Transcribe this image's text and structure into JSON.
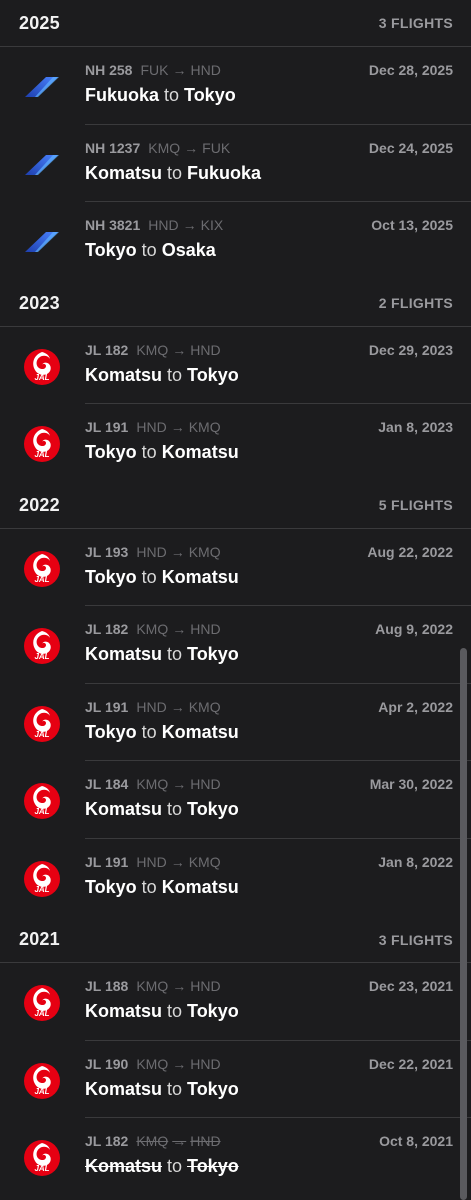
{
  "sections": [
    {
      "year": "2025",
      "count": "3 FLIGHTS",
      "flights": [
        {
          "airline": "ana-logo",
          "flight": "NH 258",
          "from": "FUK",
          "arrow": "→",
          "to_code": "HND",
          "date": "Dec 28, 2025",
          "origin": "Fukuoka",
          "connector": "to",
          "destination": "Tokyo"
        },
        {
          "airline": "ana-logo",
          "flight": "NH 1237",
          "from": "KMQ",
          "arrow": "→",
          "to_code": "FUK",
          "date": "Dec 24, 2025",
          "origin": "Komatsu",
          "connector": "to",
          "destination": "Fukuoka"
        },
        {
          "airline": "ana-logo",
          "flight": "NH 3821",
          "from": "HND",
          "arrow": "→",
          "to_code": "KIX",
          "date": "Oct 13, 2025",
          "origin": "Tokyo",
          "connector": "to",
          "destination": "Osaka"
        }
      ]
    },
    {
      "year": "2023",
      "count": "2 FLIGHTS",
      "flights": [
        {
          "airline": "jal-logo",
          "flight": "JL 182",
          "from": "KMQ",
          "arrow": "→",
          "to_code": "HND",
          "date": "Dec 29, 2023",
          "origin": "Komatsu",
          "connector": "to",
          "destination": "Tokyo"
        },
        {
          "airline": "jal-logo",
          "flight": "JL 191",
          "from": "HND",
          "arrow": "→",
          "to_code": "KMQ",
          "date": "Jan 8, 2023",
          "origin": "Tokyo",
          "connector": "to",
          "destination": "Komatsu"
        }
      ]
    },
    {
      "year": "2022",
      "count": "5 FLIGHTS",
      "flights": [
        {
          "airline": "jal-logo",
          "flight": "JL 193",
          "from": "HND",
          "arrow": "→",
          "to_code": "KMQ",
          "date": "Aug 22, 2022",
          "origin": "Tokyo",
          "connector": "to",
          "destination": "Komatsu"
        },
        {
          "airline": "jal-logo",
          "flight": "JL 182",
          "from": "KMQ",
          "arrow": "→",
          "to_code": "HND",
          "date": "Aug 9, 2022",
          "origin": "Komatsu",
          "connector": "to",
          "destination": "Tokyo"
        },
        {
          "airline": "jal-logo",
          "flight": "JL 191",
          "from": "HND",
          "arrow": "→",
          "to_code": "KMQ",
          "date": "Apr 2, 2022",
          "origin": "Tokyo",
          "connector": "to",
          "destination": "Komatsu"
        },
        {
          "airline": "jal-logo",
          "flight": "JL 184",
          "from": "KMQ",
          "arrow": "→",
          "to_code": "HND",
          "date": "Mar 30, 2022",
          "origin": "Komatsu",
          "connector": "to",
          "destination": "Tokyo"
        },
        {
          "airline": "jal-logo",
          "flight": "JL 191",
          "from": "HND",
          "arrow": "→",
          "to_code": "KMQ",
          "date": "Jan 8, 2022",
          "origin": "Tokyo",
          "connector": "to",
          "destination": "Komatsu"
        }
      ]
    },
    {
      "year": "2021",
      "count": "3 FLIGHTS",
      "flights": [
        {
          "airline": "jal-logo",
          "flight": "JL 188",
          "from": "KMQ",
          "arrow": "→",
          "to_code": "HND",
          "date": "Dec 23, 2021",
          "origin": "Komatsu",
          "connector": "to",
          "destination": "Tokyo"
        },
        {
          "airline": "jal-logo",
          "flight": "JL 190",
          "from": "KMQ",
          "arrow": "→",
          "to_code": "HND",
          "date": "Dec 22, 2021",
          "origin": "Komatsu",
          "connector": "to",
          "destination": "Tokyo"
        },
        {
          "airline": "jal-logo",
          "flight": "JL 182",
          "from": "KMQ",
          "arrow": "→",
          "to_code": "HND",
          "date": "Oct 8, 2021",
          "origin": "Komatsu",
          "connector": "to",
          "destination": "Tokyo",
          "cancelled": true
        }
      ]
    }
  ],
  "colors": {
    "background": "#1c1c1e",
    "divider": "#3a3a3c",
    "secondary_text": "#9a9a9e",
    "ana_blue": "#2f5fd8",
    "jal_red": "#e60012"
  }
}
